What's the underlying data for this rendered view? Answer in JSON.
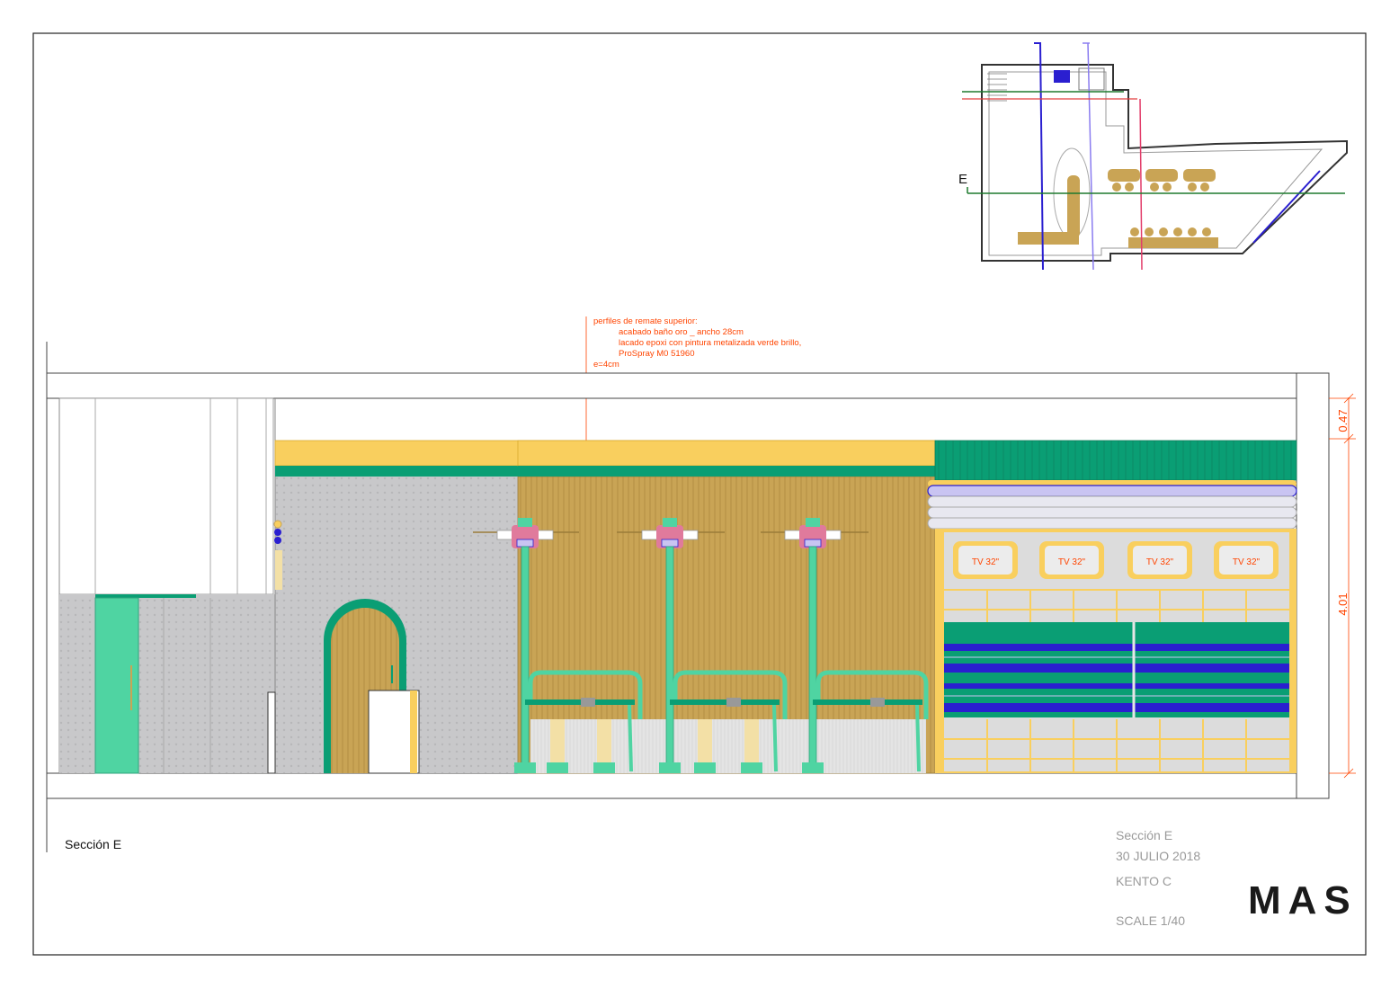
{
  "section_label": "Sección E",
  "annotation": {
    "lines": [
      "perfiles de remate superior:",
      "acabado baño oro _  ancho 28cm",
      "lacado epoxi con pintura metalizada verde brillo,",
      "ProSpray M0 51960",
      "e=4cm"
    ]
  },
  "dimensions": {
    "upper": "0.47",
    "main": "4.01"
  },
  "tv_labels": [
    "TV 32\"",
    "TV 32\"",
    "TV 32\"",
    "TV 32\""
  ],
  "plan_marker": "E",
  "title_block": {
    "section": "Sección E",
    "date": "30 JULIO 2018",
    "project": "KENTO C",
    "scale": "SCALE 1/40",
    "logo": "MAS"
  },
  "colors": {
    "green": "#0a9e74",
    "mint": "#4fd4a2",
    "yellow": "#f9cf5e",
    "wood": "#c9a455",
    "gray": "#c9c9cb",
    "blue": "#2a1fd0",
    "dimension": "#ff4400",
    "pink": "#e07a9c",
    "lavender": "#c9c4f2"
  }
}
